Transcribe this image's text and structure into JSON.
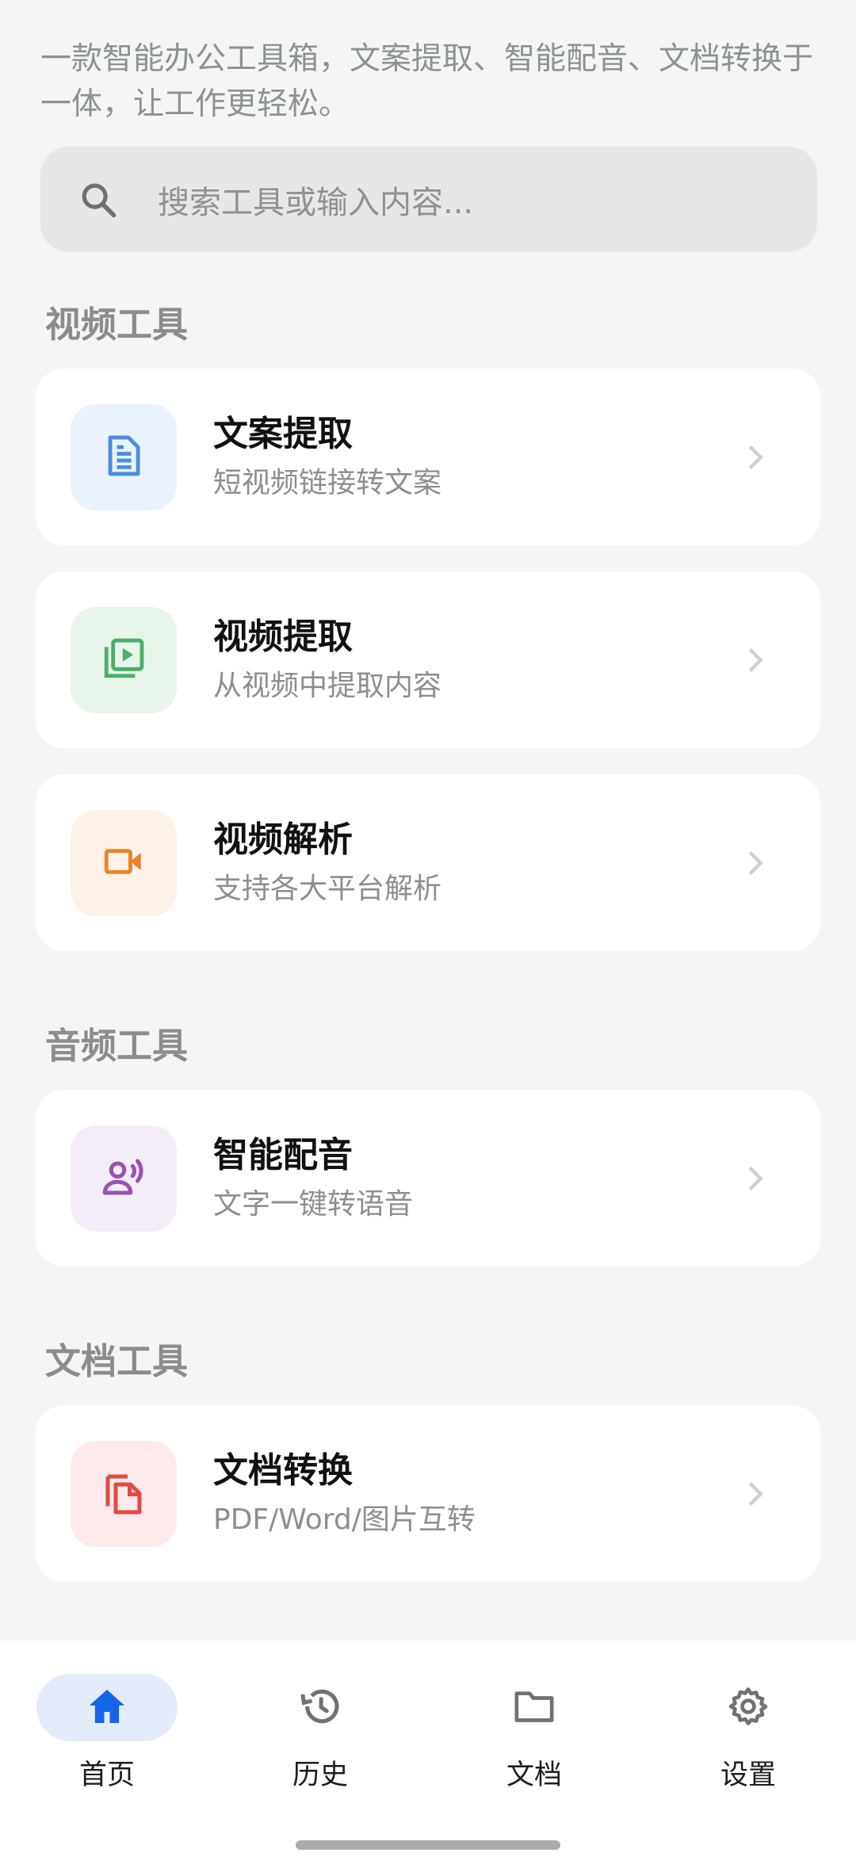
{
  "intro_text": "一款智能办公工具箱，文案提取、智能配音、文档转换于一体，让工作更轻松。",
  "search": {
    "placeholder": "搜索工具或输入内容..."
  },
  "sections": {
    "video": {
      "title": "视频工具",
      "items": [
        {
          "title": "文案提取",
          "subtitle": "短视频链接转文案",
          "icon": "document-icon",
          "color": "#4a8fdc",
          "tile": "#eaf2fd"
        },
        {
          "title": "视频提取",
          "subtitle": "从视频中提取内容",
          "icon": "video-library-icon",
          "color": "#4caf6a",
          "tile": "#e8f5ea"
        },
        {
          "title": "视频解析",
          "subtitle": "支持各大平台解析",
          "icon": "videocam-icon",
          "color": "#e8842b",
          "tile": "#fdf2e7"
        }
      ]
    },
    "audio": {
      "title": "音频工具",
      "items": [
        {
          "title": "智能配音",
          "subtitle": "文字一键转语音",
          "icon": "voice-speaker-icon",
          "color": "#9a4fb3",
          "tile": "#f4edf7"
        }
      ]
    },
    "doc": {
      "title": "文档工具",
      "items": [
        {
          "title": "文档转换",
          "subtitle": "PDF/Word/图片互转",
          "icon": "file-copy-icon",
          "color": "#e04a44",
          "tile": "#fcebea"
        }
      ]
    }
  },
  "nav": {
    "items": [
      {
        "label": "首页",
        "icon": "home-icon",
        "active": true
      },
      {
        "label": "历史",
        "icon": "history-icon",
        "active": false
      },
      {
        "label": "文档",
        "icon": "folder-icon",
        "active": false
      },
      {
        "label": "设置",
        "icon": "gear-icon",
        "active": false
      }
    ],
    "active_color": "#1565e8",
    "inactive_color": "#6f7275"
  }
}
